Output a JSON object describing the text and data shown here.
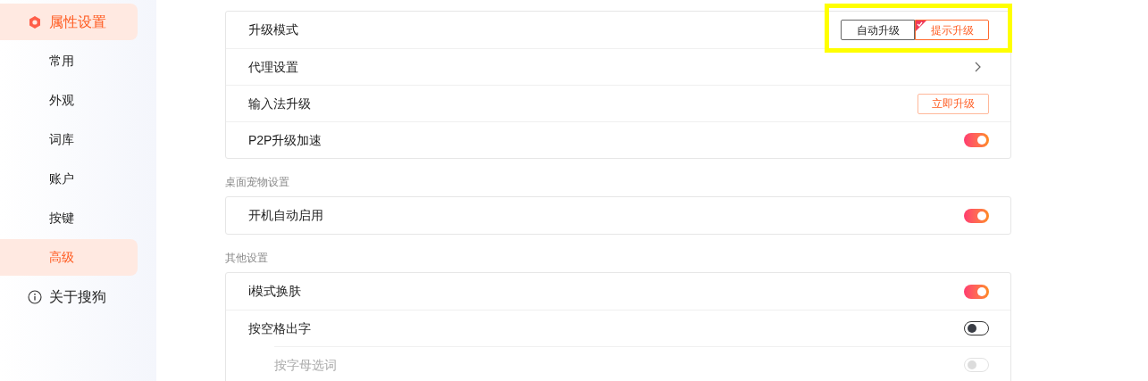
{
  "sidebar": {
    "group": {
      "label": "属性设置",
      "selected": true,
      "children": [
        {
          "label": "常用",
          "selected": false
        },
        {
          "label": "外观",
          "selected": false
        },
        {
          "label": "词库",
          "selected": false
        },
        {
          "label": "账户",
          "selected": false
        },
        {
          "label": "按键",
          "selected": false
        },
        {
          "label": "高级",
          "selected": true
        }
      ]
    },
    "items": [
      {
        "label": "关于搜狗"
      }
    ]
  },
  "sections": [
    {
      "rows": [
        {
          "label": "升级模式",
          "kind": "segmented",
          "options": [
            {
              "label": "自动升级",
              "selected": false
            },
            {
              "label": "提示升级",
              "selected": true
            }
          ]
        },
        {
          "label": "代理设置",
          "kind": "link"
        },
        {
          "label": "输入法升级",
          "kind": "button",
          "button": "立即升级"
        },
        {
          "label": "P2P升级加速",
          "kind": "toggle",
          "on": true,
          "disabled": false
        }
      ]
    },
    {
      "title": "桌面宠物设置",
      "rows": [
        {
          "label": "开机自动启用",
          "kind": "toggle",
          "on": true,
          "disabled": false
        }
      ]
    },
    {
      "title": "其他设置",
      "rows": [
        {
          "label": "i模式换肤",
          "kind": "toggle",
          "on": true,
          "disabled": false
        },
        {
          "label": "按空格出字",
          "kind": "toggle",
          "on": false,
          "disabled": false,
          "children": [
            {
              "label": "按字母选词",
              "kind": "toggle",
              "on": false,
              "disabled": true
            }
          ]
        }
      ]
    }
  ]
}
